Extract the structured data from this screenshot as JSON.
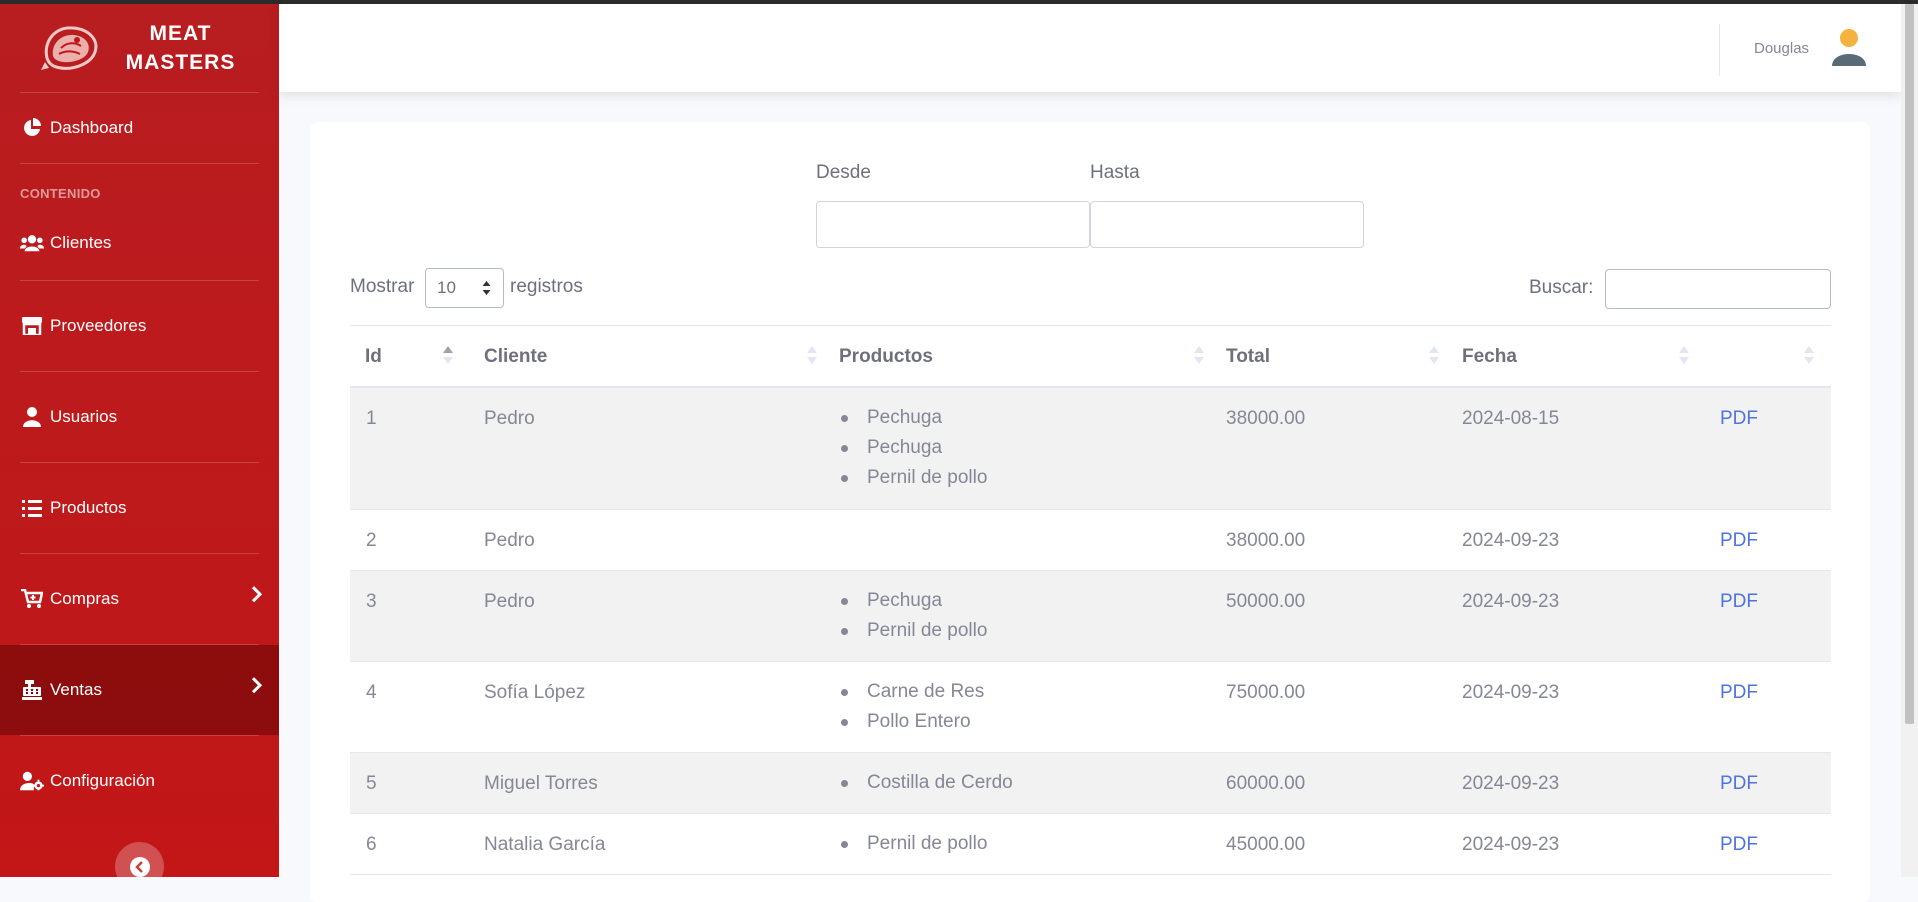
{
  "brand": {
    "line1": "MEAT",
    "line2": "MASTERS"
  },
  "sidebar": {
    "dashboard": "Dashboard",
    "section_heading": "CONTENIDO",
    "items": [
      {
        "label": "Clientes",
        "icon": "users-icon"
      },
      {
        "label": "Proveedores",
        "icon": "store-icon"
      },
      {
        "label": "Usuarios",
        "icon": "user-icon"
      },
      {
        "label": "Productos",
        "icon": "list-icon"
      },
      {
        "label": "Compras",
        "icon": "cart-icon",
        "chevron": true
      },
      {
        "label": "Ventas",
        "icon": "cash-register-icon",
        "chevron": true,
        "active": true
      },
      {
        "label": "Configuración",
        "icon": "user-gear-icon"
      }
    ]
  },
  "topbar": {
    "user_name": "Douglas"
  },
  "filters": {
    "from_label": "Desde",
    "from_value": "",
    "to_label": "Hasta",
    "to_value": ""
  },
  "length": {
    "prefix": "Mostrar",
    "value": "10",
    "suffix": "registros"
  },
  "search": {
    "label": "Buscar:",
    "value": ""
  },
  "table": {
    "columns": [
      "Id",
      "Cliente",
      "Productos",
      "Total",
      "Fecha",
      ""
    ],
    "rows": [
      {
        "id": "1",
        "cliente": "Pedro",
        "productos": [
          "Pechuga",
          "Pechuga",
          "Pernil de pollo"
        ],
        "total": "38000.00",
        "fecha": "2024-08-15",
        "action": "PDF"
      },
      {
        "id": "2",
        "cliente": "Pedro",
        "productos": [],
        "total": "38000.00",
        "fecha": "2024-09-23",
        "action": "PDF"
      },
      {
        "id": "3",
        "cliente": "Pedro",
        "productos": [
          "Pechuga",
          "Pernil de pollo"
        ],
        "total": "50000.00",
        "fecha": "2024-09-23",
        "action": "PDF"
      },
      {
        "id": "4",
        "cliente": "Sofía López",
        "productos": [
          "Carne de Res",
          "Pollo Entero"
        ],
        "total": "75000.00",
        "fecha": "2024-09-23",
        "action": "PDF"
      },
      {
        "id": "5",
        "cliente": "Miguel Torres",
        "productos": [
          "Costilla de Cerdo"
        ],
        "total": "60000.00",
        "fecha": "2024-09-23",
        "action": "PDF"
      },
      {
        "id": "6",
        "cliente": "Natalia García",
        "productos": [
          "Pernil de pollo"
        ],
        "total": "45000.00",
        "fecha": "2024-09-23",
        "action": "PDF"
      }
    ]
  },
  "colors": {
    "sidebar": "#c21617",
    "link": "#4e73df",
    "text": "#858796",
    "avatar_head": "#f6b23e",
    "avatar_body": "#5a6b78"
  }
}
